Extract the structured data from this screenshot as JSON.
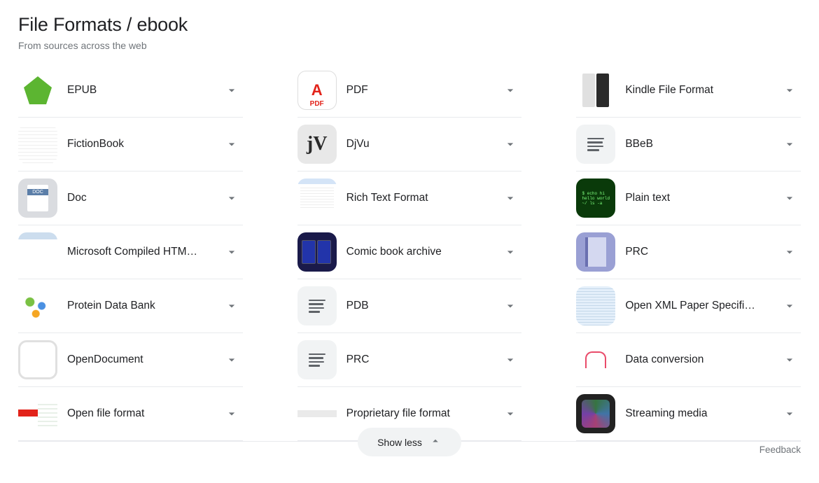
{
  "header": {
    "title": "File Formats / ebook",
    "subtitle": "From sources across the web"
  },
  "items": [
    {
      "label": "EPUB",
      "icon": "epub"
    },
    {
      "label": "PDF",
      "icon": "pdf"
    },
    {
      "label": "Kindle File Format",
      "icon": "kindle"
    },
    {
      "label": "FictionBook",
      "icon": "fictionbook"
    },
    {
      "label": "DjVu",
      "icon": "djvu"
    },
    {
      "label": "BBeB",
      "icon": "text-lines"
    },
    {
      "label": "Doc",
      "icon": "doc"
    },
    {
      "label": "Rich Text Format",
      "icon": "rtf"
    },
    {
      "label": "Plain text",
      "icon": "plain-text"
    },
    {
      "label": "Microsoft Compiled HTM…",
      "icon": "chm"
    },
    {
      "label": "Comic book archive",
      "icon": "comic"
    },
    {
      "label": "PRC",
      "icon": "prc"
    },
    {
      "label": "Protein Data Bank",
      "icon": "pdb-mol"
    },
    {
      "label": "PDB",
      "icon": "text-lines"
    },
    {
      "label": "Open XML Paper Specifi…",
      "icon": "oxps"
    },
    {
      "label": "OpenDocument",
      "icon": "opendoc"
    },
    {
      "label": "PRC",
      "icon": "text-lines"
    },
    {
      "label": "Data conversion",
      "icon": "data-conv"
    },
    {
      "label": "Open file format",
      "icon": "off"
    },
    {
      "label": "Proprietary file format",
      "icon": "prop"
    },
    {
      "label": "Streaming media",
      "icon": "stream"
    }
  ],
  "footer": {
    "show_less": "Show less",
    "feedback": "Feedback"
  }
}
